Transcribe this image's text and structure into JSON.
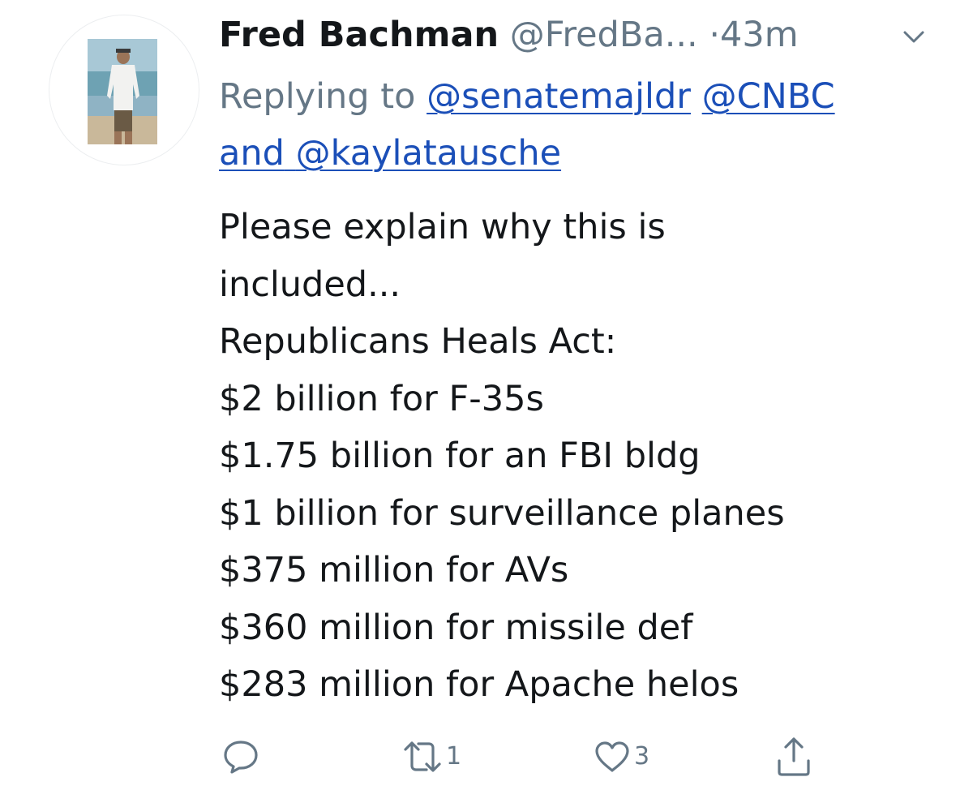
{
  "tweet": {
    "display_name": "Fred Bachman",
    "handle": "@FredBa...",
    "separator": "·",
    "time": "43m",
    "replying_prefix": "Replying to",
    "reply_mentions": [
      "@senatemajldr",
      "@CNBC"
    ],
    "reply_conjunction": "and",
    "reply_last_mention": "@kaylatausche",
    "body_lines": [
      "Please explain why this is",
      "included...",
      "Republicans Heals Act:",
      "$2 billion for F-35s",
      "$1.75 billion for an FBI bldg",
      "$1 billion for surveillance planes",
      "$375 million for AVs",
      "$360 million for missile def",
      "$283 million for Apache helos"
    ],
    "actions": {
      "reply_icon": "speech-bubble-icon",
      "retweet_icon": "retweet-icon",
      "retweet_count": "1",
      "like_icon": "heart-icon",
      "like_count": "3",
      "share_icon": "share-icon"
    }
  },
  "colors": {
    "text": "#14171a",
    "secondary": "#657786",
    "link": "#1b4fb8",
    "icon": "#657786"
  }
}
